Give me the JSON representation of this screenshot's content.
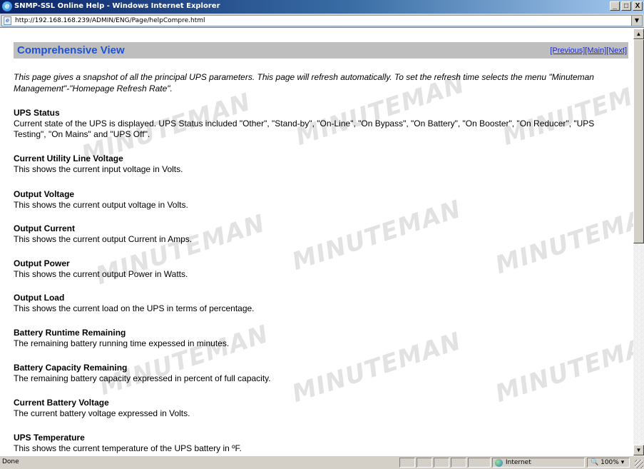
{
  "window": {
    "title": "SNMP-SSL Online Help - Windows Internet Explorer",
    "minimize": "_",
    "maximize": "□",
    "close": "X"
  },
  "address": {
    "url": "http://192.168.168.239/ADMIN/ENG/Page/helpCompre.html"
  },
  "page": {
    "heading": "Comprehensive View",
    "nav": {
      "previous": "[Previous]",
      "main": "[Main]",
      "next": "[Next]"
    },
    "intro": "This page gives a snapshot of all the principal UPS parameters. This page will refresh automatically. To set the refresh time selects the menu \"Minuteman Management\"-\"Homepage Refresh Rate\".",
    "sections": [
      {
        "title": "UPS Status",
        "text": "Current state of the UPS is displayed. UPS Status included \"Other\", \"Stand-by\", \"On-Line\", \"On Bypass\", \"On Battery\", \"On Booster\", \"On Reducer\", \"UPS Testing\", \"On Mains\" and \"UPS Off\"."
      },
      {
        "title": "Current Utility Line Voltage",
        "text": "This shows the current input voltage in Volts."
      },
      {
        "title": "Output Voltage",
        "text": "This shows the current output voltage in Volts."
      },
      {
        "title": "Output Current",
        "text": "This shows the current output Current in Amps."
      },
      {
        "title": "Output Power",
        "text": "This shows the current output Power in Watts."
      },
      {
        "title": "Output Load",
        "text": "This shows the current load on the UPS in terms of percentage."
      },
      {
        "title": "Battery Runtime Remaining",
        "text": "The remaining battery running time expessed in minutes."
      },
      {
        "title": "Battery Capacity Remaining",
        "text": "The remaining battery capacity expressed in percent of full capacity."
      },
      {
        "title": "Current Battery Voltage",
        "text": "The current battery voltage expressed in Volts."
      },
      {
        "title": "UPS Temperature",
        "text": "This shows the current temperature of the UPS battery in ºF."
      }
    ],
    "watermark": "MINUTEMAN"
  },
  "status": {
    "text": "Done",
    "zone": "Internet",
    "zoom": "100%"
  },
  "colors": {
    "heading": "#1e52d6",
    "header_bg": "#bebebe",
    "link": "#1d28cf"
  }
}
